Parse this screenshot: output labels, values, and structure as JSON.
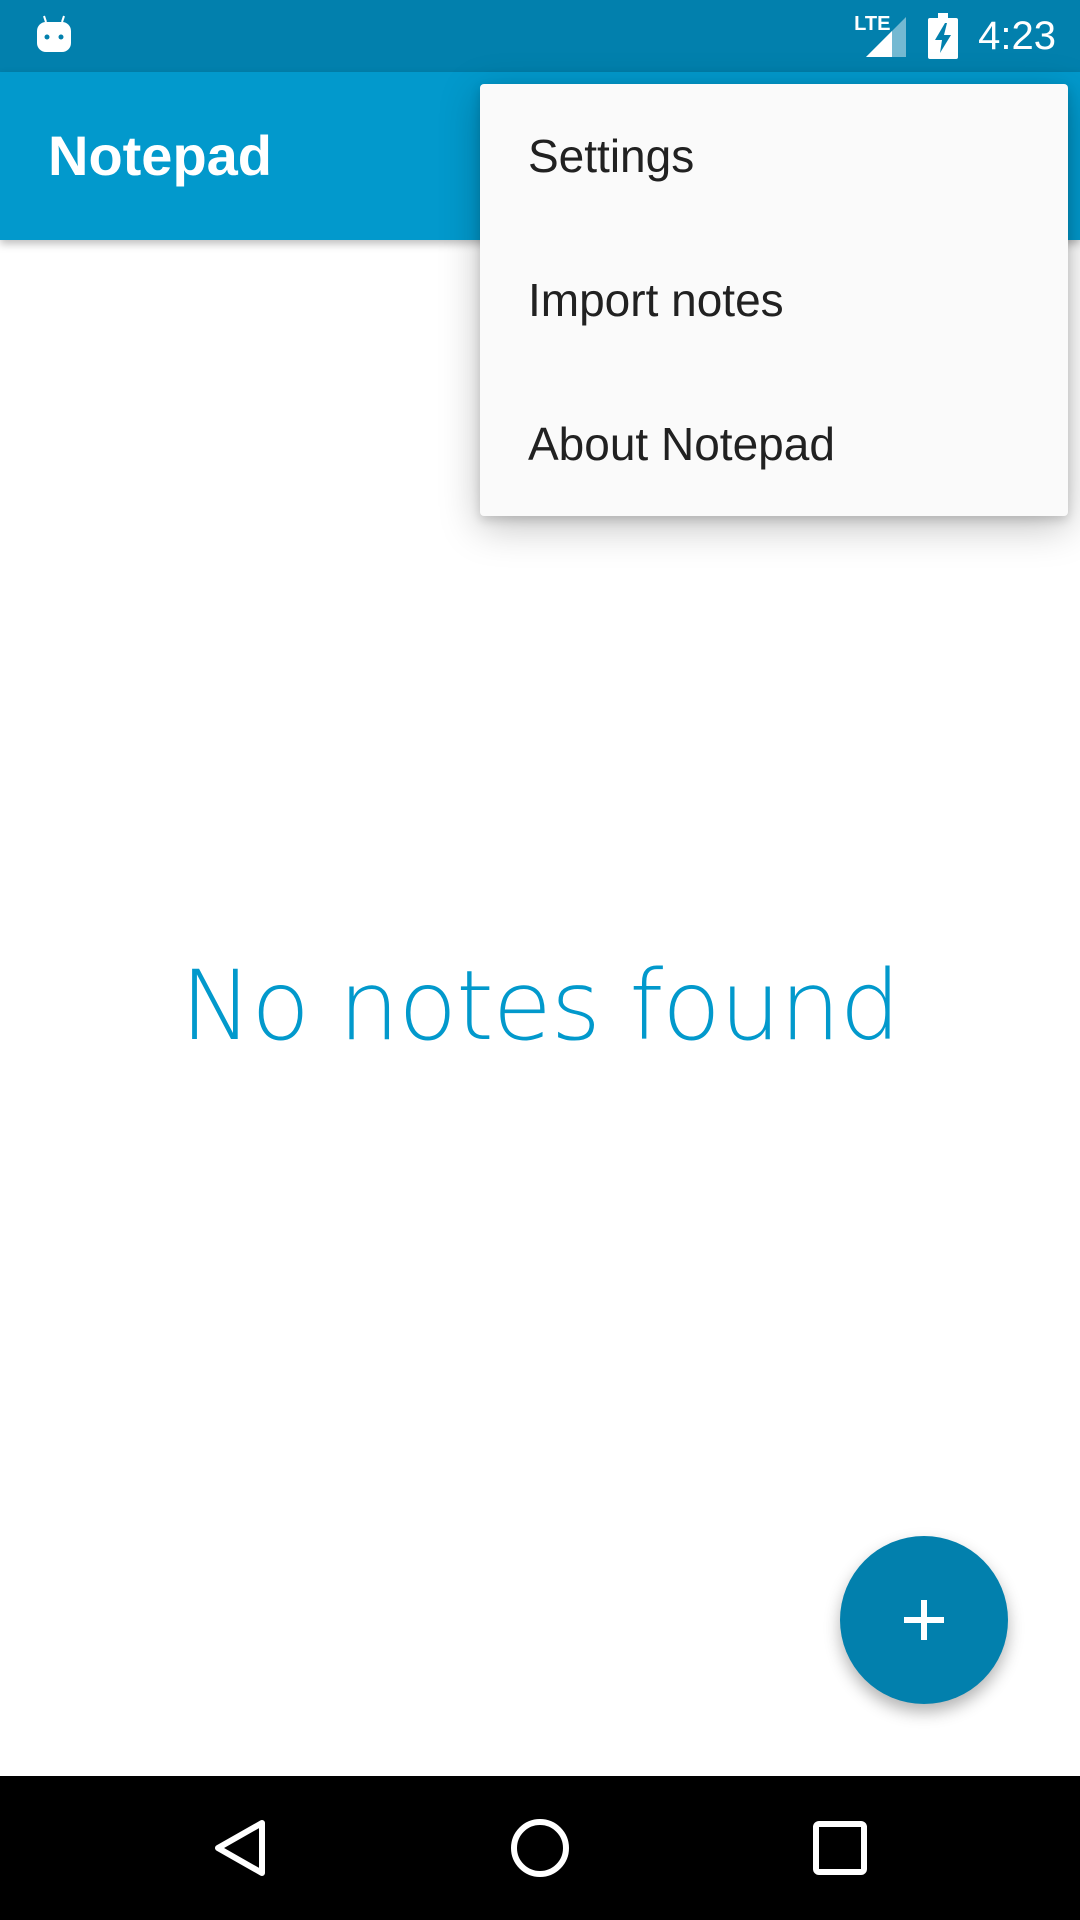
{
  "status_bar": {
    "time": "4:23",
    "network_label": "LTE",
    "icons": [
      "android-app-icon",
      "lte-signal-icon",
      "battery-charging-icon"
    ]
  },
  "app_bar": {
    "title": "Notepad"
  },
  "overflow_menu": {
    "items": [
      {
        "label": "Settings"
      },
      {
        "label": "Import notes"
      },
      {
        "label": "About Notepad"
      }
    ]
  },
  "main": {
    "empty_message": "No notes found"
  },
  "fab": {
    "icon": "plus-icon"
  },
  "nav_bar": {
    "icons": [
      "back-icon",
      "home-icon",
      "recents-icon"
    ]
  },
  "colors": {
    "primary": "#0299cc",
    "primary_dark": "#0280ad",
    "menu_background": "#fafafa",
    "menu_text": "#212121"
  }
}
